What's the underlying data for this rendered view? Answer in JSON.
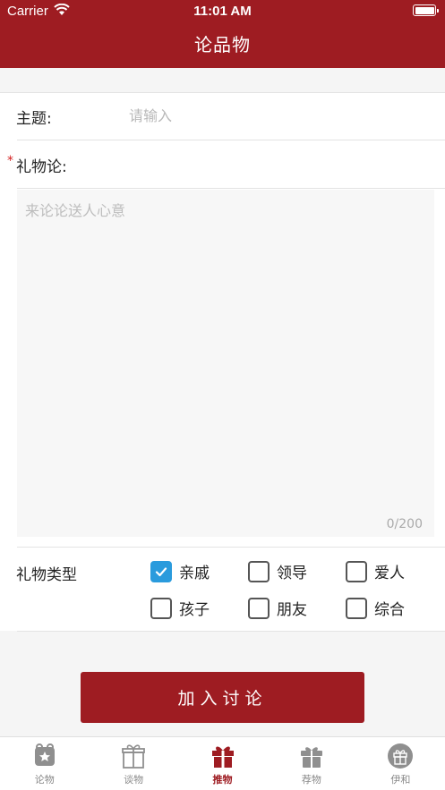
{
  "status_bar": {
    "carrier": "Carrier",
    "time": "11:01 AM"
  },
  "nav": {
    "title": "论品物"
  },
  "form": {
    "subject_label": "主题:",
    "subject_placeholder": "请输入",
    "required_mark": "*",
    "gift_label": "礼物论:",
    "textarea_placeholder": "来论论送人心意",
    "counter": "0/200",
    "type_label": "礼物类型",
    "types": [
      {
        "label": "亲戚",
        "checked": true
      },
      {
        "label": "领导",
        "checked": false
      },
      {
        "label": "爱人",
        "checked": false
      },
      {
        "label": "孩子",
        "checked": false
      },
      {
        "label": "朋友",
        "checked": false
      },
      {
        "label": "综合",
        "checked": false
      }
    ],
    "submit_label": "加入讨论"
  },
  "tabs": [
    {
      "label": "论物",
      "icon": "star-badge-icon",
      "active": false
    },
    {
      "label": "谈物",
      "icon": "gift-box-outline-icon",
      "active": false
    },
    {
      "label": "推物",
      "icon": "gift-icon",
      "active": true
    },
    {
      "label": "荐物",
      "icon": "present-icon",
      "active": false
    },
    {
      "label": "伊和",
      "icon": "gift-circle-icon",
      "active": false
    }
  ],
  "colors": {
    "brand": "#9e1c22",
    "check": "#2a9bdd"
  }
}
